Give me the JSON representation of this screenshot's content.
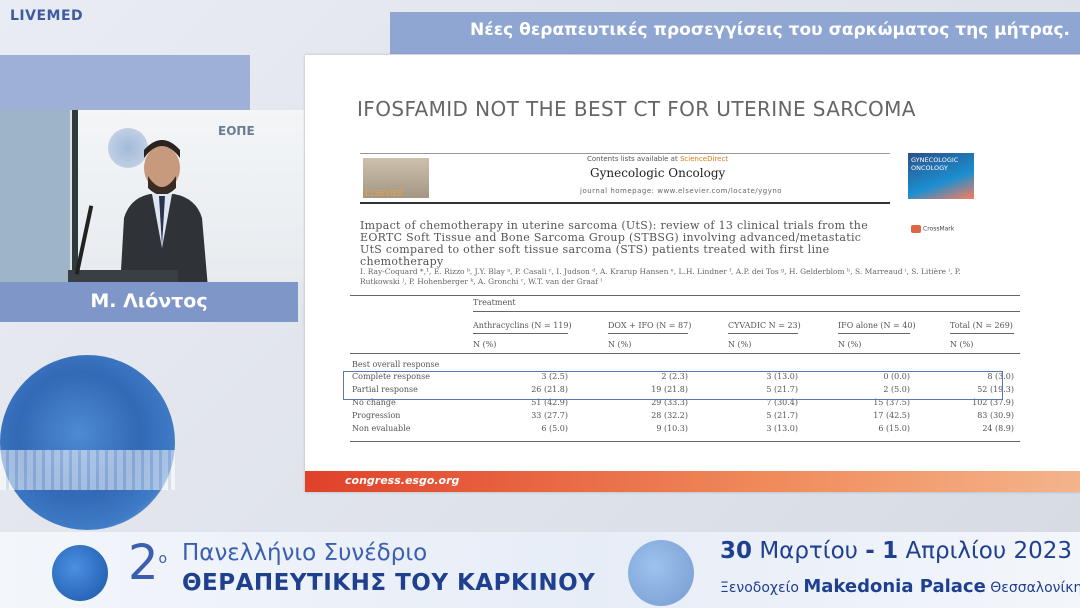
{
  "header": {
    "brand": "LIVEMED",
    "topic": "Νέες θεραπευτικές προσεγγίσεις του σαρκώματος της μήτρας."
  },
  "speaker": {
    "name": "Μ. Λιόντος",
    "banner_text": "ΕΟΠΕ"
  },
  "slide": {
    "title": "IFOSFAMID NOT THE BEST CT FOR UTERINE SARCOMA",
    "journal": {
      "contents_prefix": "Contents lists available at",
      "contents_link": "ScienceDirect",
      "name": "Gynecologic Oncology",
      "homepage": "journal homepage: www.elsevier.com/locate/ygyno",
      "publisher": "ELSEVIER",
      "cover_title": "GYNECOLOGIC ONCOLOGY",
      "crossmark": "CrossMark"
    },
    "article_title": "Impact of chemotherapy in uterine sarcoma (UtS): review of 13 clinical trials from the EORTC Soft Tissue and Bone Sarcoma Group (STBSG) involving advanced/metastatic UtS compared to other soft tissue sarcoma (STS) patients treated with first line chemotherapy",
    "authors": "I. Ray-Coquard *,¹, E. Rizzo ᵇ, J.Y. Blay ᵃ, P. Casali ᶜ, I. Judson ᵈ, A. Krarup Hansen ᵉ, L.H. Lindner ᶠ, A.P. dei Tos ᵍ, H. Gelderblom ʰ, S. Marreaud ⁱ, S. Litière ⁱ, P. Rutkowski ʲ, P. Hohenberger ᵏ, A. Gronchi ᶜ, W.T. van der Graaf ˡ",
    "table": {
      "group_header": "Treatment",
      "columns": [
        "Anthracyclins (N = 119)",
        "DOX + IFO (N = 87)",
        "CYVADIC N = 23)",
        "IFO alone (N = 40)",
        "Total (N = 269)"
      ],
      "subheader": "N (%)",
      "section": "Best overall response",
      "rows": [
        {
          "label": "Complete response",
          "values": [
            "3 (2.5)",
            "2 (2.3)",
            "3 (13.0)",
            "0 (0.0)",
            "8 (3.0)"
          ]
        },
        {
          "label": "Partial response",
          "values": [
            "26 (21.8)",
            "19 (21.8)",
            "5 (21.7)",
            "2 (5.0)",
            "52 (19.3)"
          ]
        },
        {
          "label": "No change",
          "values": [
            "51 (42.9)",
            "29 (33.3)",
            "7 (30.4)",
            "15 (37.5)",
            "102 (37.9)"
          ]
        },
        {
          "label": "Progression",
          "values": [
            "33 (27.7)",
            "28 (32.2)",
            "5 (21.7)",
            "17 (42.5)",
            "83 (30.9)"
          ]
        },
        {
          "label": "Non evaluable",
          "values": [
            "6 (5.0)",
            "9 (10.3)",
            "3 (13.0)",
            "6 (15.0)",
            "24 (8.9)"
          ]
        }
      ]
    },
    "footer": "congress.esgo.org"
  },
  "bottom": {
    "ordinal": "2",
    "ordinal_suffix": "ο",
    "line1": "Πανελλήνιο Συνέδριο",
    "line2": "ΘΕΡΑΠΕΥΤΙΚΗΣ ΤΟΥ ΚΑΡΚΙΝΟΥ",
    "date_a": "30",
    "month_a": "Μαρτίου",
    "date_sep": "-",
    "date_b": "1",
    "month_b": "Απριλίου 2023",
    "venue_prefix": "Ξενοδοχείο",
    "venue_name": "Makedonia Palace",
    "venue_city": "Θεσσαλονίκη"
  }
}
